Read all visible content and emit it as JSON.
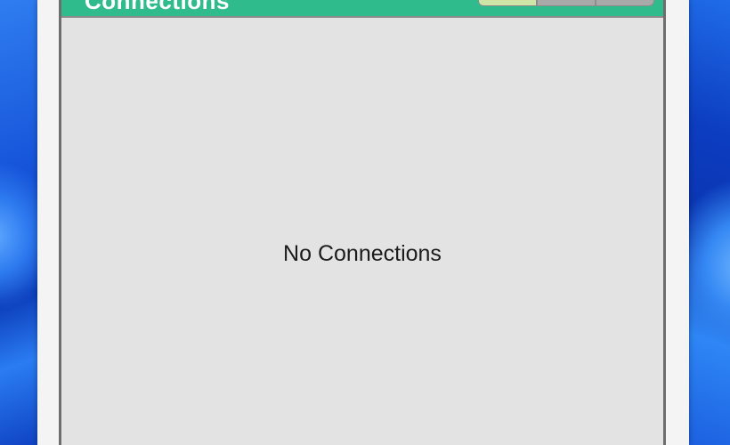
{
  "panel": {
    "title": "Connections",
    "header_color": "#2fbb8c",
    "empty_message": "No Connections",
    "header_buttons": [
      {
        "icon": "add-icon",
        "color": "#cfe5a8"
      },
      {
        "icon": "edit-icon",
        "color": "#a9a9a9"
      },
      {
        "icon": "remove-icon",
        "color": "#a9a9a9"
      }
    ]
  },
  "desktop": {
    "wallpaper_accent": "#1a4fd0"
  }
}
